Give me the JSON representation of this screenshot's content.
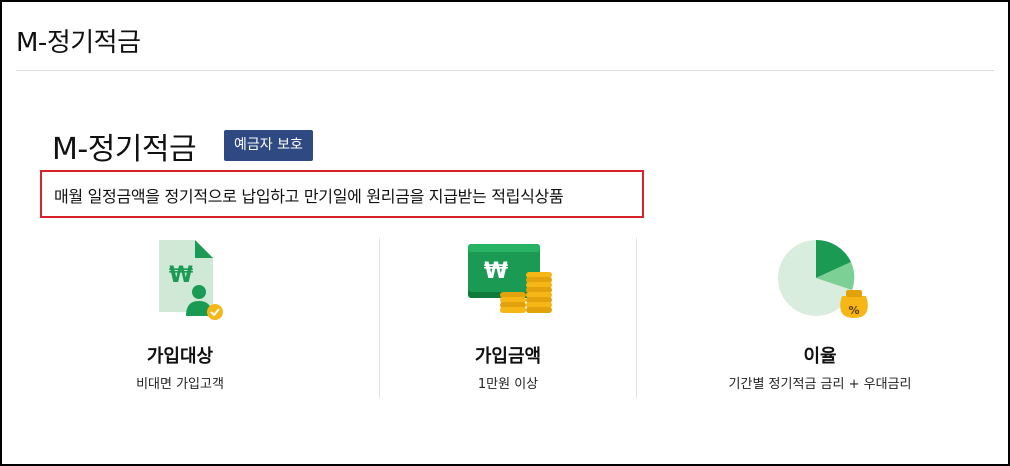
{
  "header": {
    "title": "M-정기적금"
  },
  "product": {
    "name": "M-정기적금",
    "badge": "예금자 보호",
    "description": "매월 일정금액을 정기적으로 납입하고 만기일에 원리금을 지급받는 적립식상품"
  },
  "features": [
    {
      "icon": "document-user-won-icon",
      "title": "가입대상",
      "subtitle": "비대면 가입고객"
    },
    {
      "icon": "cash-coins-icon",
      "title": "가입금액",
      "subtitle": "1만원 이상"
    },
    {
      "icon": "pie-chart-percent-icon",
      "title": "이율",
      "subtitle": "기간별 정기적금 금리 + 우대금리"
    }
  ],
  "colors": {
    "badge_bg": "#2f4a83",
    "highlight_border": "#d8232a",
    "brand_green": "#1a9a52",
    "coin_gold": "#f6b616"
  }
}
